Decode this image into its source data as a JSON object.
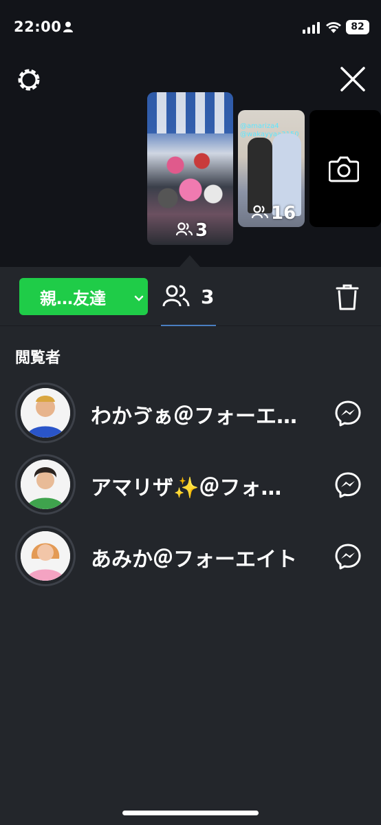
{
  "status_bar": {
    "time": "22:00",
    "battery": "82"
  },
  "stories": [
    {
      "viewer_count": "3",
      "selected": true
    },
    {
      "viewer_count": "16",
      "mentions": [
        "@amariza4",
        "@wakayyaa3150"
      ]
    },
    {
      "type": "camera",
      "icon": "camera-icon"
    }
  ],
  "toolbar": {
    "audience_label": "親…友達",
    "viewers_count": "3"
  },
  "viewers_section": {
    "title": "閲覧者",
    "viewers": [
      {
        "name": "わかゔぁ＠フォーエ…",
        "icon": "messenger-icon"
      },
      {
        "name": "アマリザ✨＠フォ…",
        "icon": "messenger-icon"
      },
      {
        "name": "あみか＠フォーエイト",
        "icon": "messenger-icon"
      }
    ]
  },
  "colors": {
    "accent_green": "#1fcc48",
    "background": "#23262b",
    "top_background": "#121419",
    "tab_underline": "#4a7fc1"
  }
}
